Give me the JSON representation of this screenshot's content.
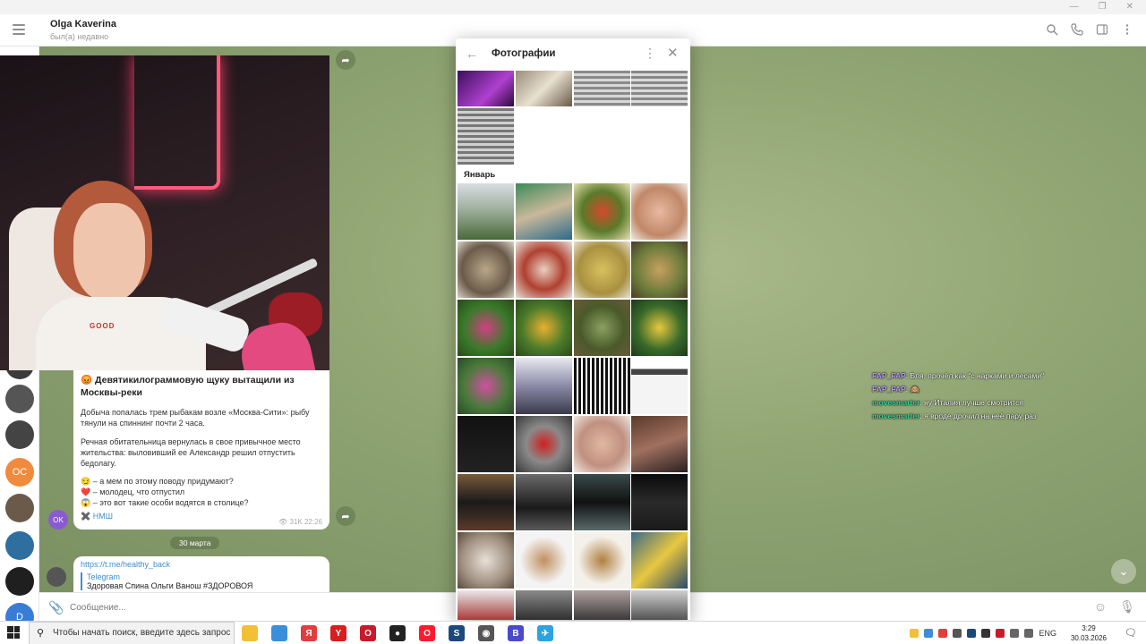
{
  "window": {
    "controls": [
      "—",
      "❐",
      "✕"
    ]
  },
  "header": {
    "title": "Olga Kaverina",
    "status": "был(а) недавно",
    "icons": [
      "search-icon",
      "phone-icon",
      "sidebar-icon",
      "more-icon"
    ]
  },
  "sidebar": {
    "avatars": [
      {
        "label": "",
        "color": "#3b3b3b"
      },
      {
        "label": "",
        "color": "#555555"
      },
      {
        "label": "",
        "color": "#444444"
      },
      {
        "label": "OC",
        "color": "#f08a3c"
      },
      {
        "label": "",
        "color": "#6b5a4a"
      },
      {
        "label": "",
        "color": "#2f6fa0"
      },
      {
        "label": "",
        "color": "#1f1f1f"
      },
      {
        "label": "D",
        "color": "#3a7bd5"
      }
    ]
  },
  "webcam": {
    "shirt_text": "GOOD"
  },
  "message": {
    "title_emoji": "😡",
    "title": "Девятикилограммовую щуку вытащили из Москвы-реки",
    "para1": "Добыча попалась трем рыбакам возле «Москва-Сити»: рыбу тянули на спиннинг почти 2 часа.",
    "para2": "Речная обитательница вернулась в свое привычное место жительства: выловивший ее Александр решил отпустить бедолагу.",
    "line1": "😏 – а мем по этому поводу придумают?",
    "line2": "❤️ – молодец, что отпустил",
    "line3": "😱 – это вот такие особи водятся в столице?",
    "signature": "✖️ НМШ",
    "views": "👁 31K",
    "time": "22:26",
    "sender_avatar": "OK"
  },
  "date_divider": "30 марта",
  "message2": {
    "link": "https://t.me/healthy_back",
    "preview_site": "Telegram",
    "preview_title": "Здоровая Спина Ольги Ванош #ЗДОРОВОЯ"
  },
  "twitch_chat": [
    {
      "user": "FAP_FAP",
      "color": "#b79cff",
      "text": ": Бля, прочёл как \"с нарками и лесами\""
    },
    {
      "user": "FAP_FAP",
      "color": "#b79cff",
      "text": ": 🙈"
    },
    {
      "user": "movesmarter",
      "color": "#3fd29b",
      "text": ": ну Италия лучше смотрится"
    },
    {
      "user": "movesmarter",
      "color": "#3fd29b",
      "text": ": я вроде дрочил на неё пару раз"
    }
  ],
  "input": {
    "placeholder": "Сообщение..."
  },
  "modal": {
    "title": "Фотографии",
    "month": "Январь",
    "photos_top": [
      {
        "name": "photo-neon-portrait",
        "bg": "linear-gradient(135deg,#3a0f5a,#b040d0 60%,#2a0a3a)"
      },
      {
        "name": "photo-cat",
        "bg": "linear-gradient(135deg,#9a8c7a,#e8e0d0 50%,#6a5a48)"
      },
      {
        "name": "photo-text-list",
        "bg": "repeating-linear-gradient(180deg,#8a8a8a 0 3px,#d8d8d8 3px 6px)"
      },
      {
        "name": "photo-text-list",
        "bg": "repeating-linear-gradient(180deg,#888 0 3px,#dadada 3px 6px)"
      },
      {
        "name": "photo-text-list",
        "bg": "repeating-linear-gradient(180deg,#777 0 3px,#d0d0d0 3px 6px)"
      }
    ],
    "photos_jan": [
      {
        "name": "photo-park",
        "bg": "linear-gradient(180deg,#d8dde2 0%,#9fb0a0 45%,#4a6a3a 100%)"
      },
      {
        "name": "photo-city-aerial",
        "bg": "linear-gradient(160deg,#3e8a5a,#c9b89a 50%,#2b6a8a)"
      },
      {
        "name": "photo-vegetables",
        "bg": "radial-gradient(circle at 50% 50%,#d44a2a,#5a7a2a 50%,#e8e0b0)"
      },
      {
        "name": "photo-shrimp",
        "bg": "radial-gradient(circle,#e8b8a0,#c08868 60%,#f0ece6)"
      },
      {
        "name": "photo-plate",
        "bg": "radial-gradient(circle,#b8a888,#6a5a4a 60%,#d8d0c0)"
      },
      {
        "name": "photo-dish",
        "bg": "radial-gradient(circle,#e8d0c0,#b04030 50%,#e8e0d8)"
      },
      {
        "name": "photo-stuffed-peppers",
        "bg": "radial-gradient(circle,#d8c060,#a89040 60%,#e8e0d0)"
      },
      {
        "name": "photo-table-food",
        "bg": "radial-gradient(circle,#c8a060,#6a7a3a 60%,#4a3a2a)"
      },
      {
        "name": "photo-flowers-pink",
        "bg": "radial-gradient(circle,#d04080,#3a7a2a 55%,#2a4a1a)"
      },
      {
        "name": "photo-lemon-tree",
        "bg": "radial-gradient(circle,#e8b030,#4a7a2a 55%,#2a4a1a)"
      },
      {
        "name": "photo-plants",
        "bg": "radial-gradient(circle,#8aa060,#4a5a2a 55%,#6a5a3a)"
      },
      {
        "name": "photo-lemons",
        "bg": "radial-gradient(circle,#e8c840,#3a6a2a 55%,#1a3a1a)"
      },
      {
        "name": "photo-garden",
        "bg": "radial-gradient(circle,#d050a0,#4a7a3a 55%,#2a4a2a)"
      },
      {
        "name": "photo-building",
        "bg": "linear-gradient(180deg,#e8e8f0,#8a8aa8 50%,#3a3a4a)"
      },
      {
        "name": "photo-qr-code",
        "bg": "repeating-linear-gradient(90deg,#111 0 3px,#fff 3px 5px)"
      },
      {
        "name": "photo-barcode-doc",
        "bg": "linear-gradient(180deg,#ffffff 0 20%,#444 20% 30%,#f4f4f4 30%)"
      },
      {
        "name": "photo-screenshot-text",
        "bg": "linear-gradient(180deg,#111 0%,#222 100%)"
      },
      {
        "name": "photo-no-sign",
        "bg": "radial-gradient(circle,#d02020,#8a8a8a 45%,#3a3a3a)"
      },
      {
        "name": "photo-woman",
        "bg": "radial-gradient(circle,#e0b8a0,#c09080 55%,#f0e8e0)"
      },
      {
        "name": "photo-gym",
        "bg": "linear-gradient(160deg,#5a3a2a,#a07060 50%,#2a2020)"
      },
      {
        "name": "photo-latex-outfit",
        "bg": "linear-gradient(180deg,#7a5a3a,#1a1a1a 50%,#5a3a2a)"
      },
      {
        "name": "photo-dark-figure",
        "bg": "linear-gradient(180deg,#6a6a6a,#1a1a1a 60%,#5a5a5a)"
      },
      {
        "name": "photo-corset",
        "bg": "linear-gradient(180deg,#3a4a4a,#111 50%,#5a6a6a)"
      },
      {
        "name": "photo-dark-portrait",
        "bg": "linear-gradient(180deg,#0a0a0a,#2a2a2a 50%,#1a1a1a)"
      },
      {
        "name": "photo-kitten",
        "bg": "radial-gradient(circle,#e8e0d8,#a09080 60%,#5a4a3a)"
      },
      {
        "name": "photo-leopard-shorts",
        "bg": "radial-gradient(circle,#c09060,#f4f4f4 60%)"
      },
      {
        "name": "photo-leopard-top",
        "bg": "radial-gradient(circle,#b08040,#f4f0ea 60%)"
      },
      {
        "name": "photo-bananas",
        "bg": "linear-gradient(135deg,#3a6a8a,#e8c840 50%,#2a4a6a)"
      },
      {
        "name": "photo-red-door",
        "bg": "linear-gradient(180deg,#e8e8e8,#a02020 60%,#5a5a5a)"
      },
      {
        "name": "photo-dark-scene",
        "bg": "linear-gradient(180deg,#8a8a8a,#222 60%)"
      },
      {
        "name": "photo-crowd",
        "bg": "linear-gradient(180deg,#b0a0a0,#2a2a2a 60%)"
      },
      {
        "name": "photo-street",
        "bg": "linear-gradient(180deg,#d0d0d0,#404040 60%)"
      }
    ]
  },
  "taskbar": {
    "search_placeholder": "Чтобы начать поиск, введите здесь запрос",
    "apps": [
      {
        "name": "file-explorer-icon",
        "label": "",
        "color": "#f2c037"
      },
      {
        "name": "store-icon",
        "label": "",
        "color": "#3a8fd8"
      },
      {
        "name": "yandex-icon",
        "label": "Я",
        "color": "#e23d3d"
      },
      {
        "name": "yandex-browser-icon",
        "label": "Y",
        "color": "#d81e1e"
      },
      {
        "name": "opera-icon",
        "label": "O",
        "color": "#c81a2a"
      },
      {
        "name": "obs-icon",
        "label": "●",
        "color": "#222222"
      },
      {
        "name": "opera-gx-icon",
        "label": "O",
        "color": "#ff1b2d"
      },
      {
        "name": "steam-icon",
        "label": "S",
        "color": "#1b4a7a"
      },
      {
        "name": "app-icon",
        "label": "◉",
        "color": "#555555"
      },
      {
        "name": "vpn-icon",
        "label": "B",
        "color": "#4a4acc"
      },
      {
        "name": "telegram-icon",
        "label": "✈",
        "color": "#2aa3e0"
      }
    ],
    "language": "ENG",
    "time": "3:29",
    "date": "30.03.2026",
    "notifications": "2"
  }
}
